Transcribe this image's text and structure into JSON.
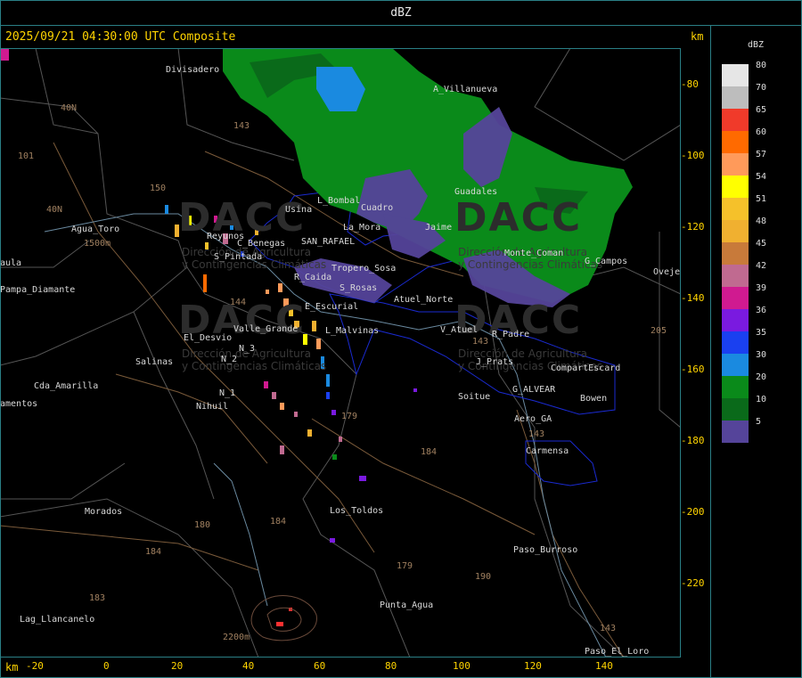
{
  "header": {
    "title": "dBZ"
  },
  "timestamp": "2025/09/21 04:30:00 UTC Composite",
  "axis_unit_top": "km",
  "axis_unit_bottom": "km",
  "y_ticks": [
    "-80",
    "-100",
    "-120",
    "-140",
    "-160",
    "-180",
    "-200",
    "-220"
  ],
  "x_ticks": [
    "-20",
    "0",
    "20",
    "40",
    "60",
    "80",
    "100",
    "120",
    "140"
  ],
  "legend": {
    "title": "dBZ",
    "items": [
      {
        "label": "80",
        "color": "#e6e6e6"
      },
      {
        "label": "70",
        "color": "#bdbdbd"
      },
      {
        "label": "65",
        "color": "#f03a2a"
      },
      {
        "label": "60",
        "color": "#ff6a00"
      },
      {
        "label": "57",
        "color": "#ff9a5a"
      },
      {
        "label": "54",
        "color": "#ffff00"
      },
      {
        "label": "51",
        "color": "#f5c12a"
      },
      {
        "label": "48",
        "color": "#f0b030"
      },
      {
        "label": "45",
        "color": "#c87a3a"
      },
      {
        "label": "42",
        "color": "#c06a90"
      },
      {
        "label": "39",
        "color": "#d01a90"
      },
      {
        "label": "36",
        "color": "#7a1ae0"
      },
      {
        "label": "35",
        "color": "#1a40f0"
      },
      {
        "label": "30",
        "color": "#1a8ae0"
      },
      {
        "label": "20",
        "color": "#0a8a1a"
      },
      {
        "label": "10",
        "color": "#0a6a1a"
      },
      {
        "label": "5",
        "color": "#55449a"
      }
    ]
  },
  "places": [
    {
      "name": "Divisadero"
    },
    {
      "name": "A_Villanueva"
    },
    {
      "name": "Guadales"
    },
    {
      "name": "Agua_Toro"
    },
    {
      "name": "Reyunos"
    },
    {
      "name": "C_Benegas"
    },
    {
      "name": "S_Pintada"
    },
    {
      "name": "SAN_RAFAEL"
    },
    {
      "name": "Usina"
    },
    {
      "name": "La_Mora"
    },
    {
      "name": "Cuadro"
    },
    {
      "name": "L_Bombal"
    },
    {
      "name": "Tropero_Sosa"
    },
    {
      "name": "R_Caida"
    },
    {
      "name": "S_Rosas"
    },
    {
      "name": "Atuel_Norte"
    },
    {
      "name": "E_Escurial"
    },
    {
      "name": "El_Desvio"
    },
    {
      "name": "Valle_Grande"
    },
    {
      "name": "L_Malvinas"
    },
    {
      "name": "V_Atuel"
    },
    {
      "name": "R_Padre"
    },
    {
      "name": "Salinas"
    },
    {
      "name": "N_2"
    },
    {
      "name": "N_3"
    },
    {
      "name": "N_1"
    },
    {
      "name": "Nihuil"
    },
    {
      "name": "J_Prats"
    },
    {
      "name": "CompartEscard"
    },
    {
      "name": "G_ALVEAR"
    },
    {
      "name": "Soitue"
    },
    {
      "name": "Bowen"
    },
    {
      "name": "Aero_GA"
    },
    {
      "name": "Carmensa"
    },
    {
      "name": "Cda_Amarilla"
    },
    {
      "name": "amentos"
    },
    {
      "name": "aula"
    },
    {
      "name": "Pampa_Diamante"
    },
    {
      "name": "Morados"
    },
    {
      "name": "Los_Toldos"
    },
    {
      "name": "Paso_Burroso"
    },
    {
      "name": "Lag_Llancanelo"
    },
    {
      "name": "Punta_Agua"
    },
    {
      "name": "Paso_El_Loro"
    },
    {
      "name": "G_Campos"
    },
    {
      "name": "Ovejer"
    },
    {
      "name": "Monte_Coman"
    },
    {
      "name": "Jaime"
    }
  ],
  "routes": [
    "101",
    "40N",
    "143",
    "150",
    "40N",
    "144",
    "179",
    "184",
    "180",
    "184",
    "183",
    "184",
    "179",
    "190",
    "143",
    "143",
    "143",
    "205",
    "1500m",
    "2200m"
  ],
  "watermark": {
    "text": "DACC",
    "subtitle1": "Dirección de Agricultura",
    "subtitle2": "y Contingencias Climáticas"
  }
}
